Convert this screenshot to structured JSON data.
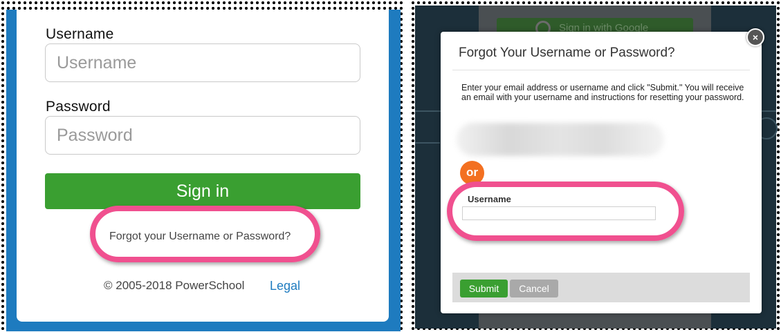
{
  "login": {
    "username_label": "Username",
    "username_placeholder": "Username",
    "password_label": "Password",
    "password_placeholder": "Password",
    "signin_label": "Sign in",
    "forgot_link": "Forgot your Username or Password?",
    "copyright": "© 2005-2018 PowerSchool",
    "legal_link": "Legal"
  },
  "background": {
    "google_button": "Sign in with Google"
  },
  "modal": {
    "title": "Forgot Your Username or Password?",
    "close_label": "×",
    "description": "Enter your email address or username and click \"Submit.\" You will receive an email with your username and instructions for resetting your password.",
    "or_label": "or",
    "username_label": "Username",
    "username_value": "",
    "submit_label": "Submit",
    "cancel_label": "Cancel"
  },
  "colors": {
    "brand_blue": "#1e7bbf",
    "signin_green": "#3a9f31",
    "highlight_pink": "#f0508f",
    "or_orange": "#f37021"
  }
}
